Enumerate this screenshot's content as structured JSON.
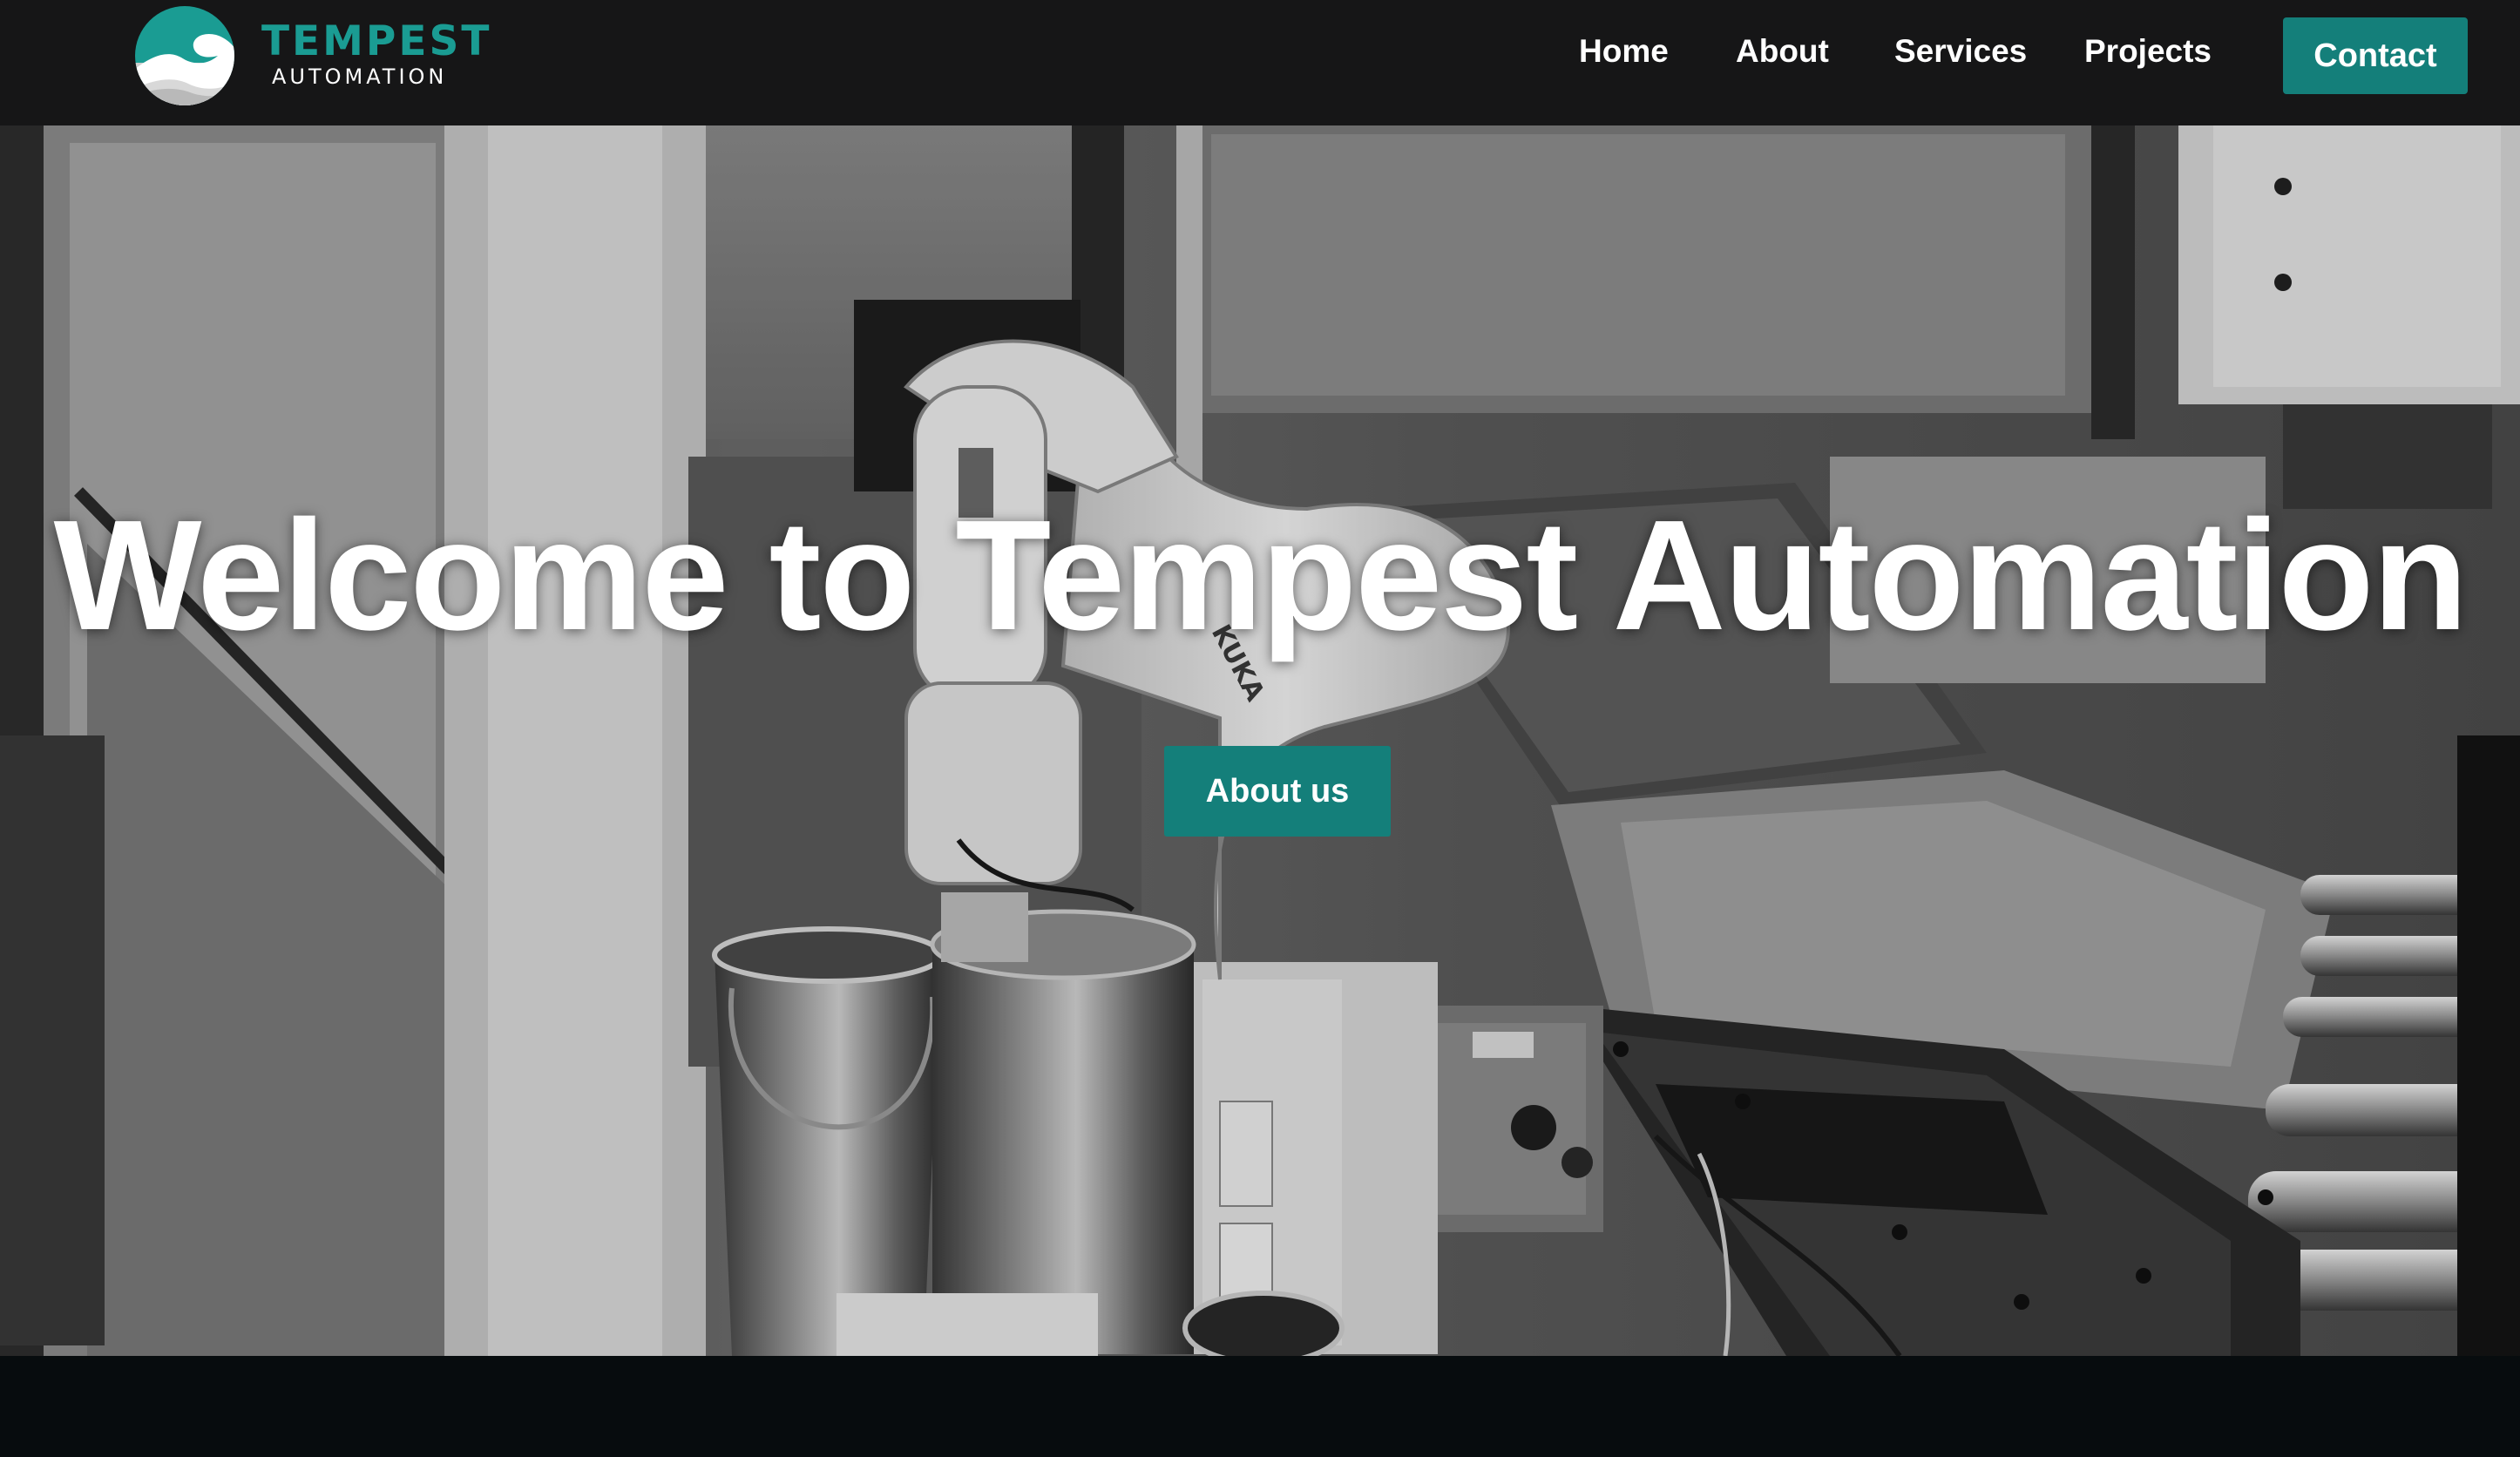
{
  "brand": {
    "name": "TEMPEST",
    "tagline": "AUTOMATION",
    "accent_color": "#1a9c93",
    "button_color": "#147f7a",
    "logo_icon": "wave-icon"
  },
  "nav": {
    "items": [
      {
        "label": "Home"
      },
      {
        "label": "About"
      },
      {
        "label": "Services"
      },
      {
        "label": "Projects"
      }
    ],
    "contact_label": "Contact"
  },
  "hero": {
    "title": "Welcome to Tempest Automation",
    "cta_label": "About us",
    "background": "grayscale-photo-industrial-robot-arm",
    "robot_label": "KUKA"
  },
  "colors": {
    "navbar_bg": "#161617",
    "footer_bg": "#070c0e"
  }
}
